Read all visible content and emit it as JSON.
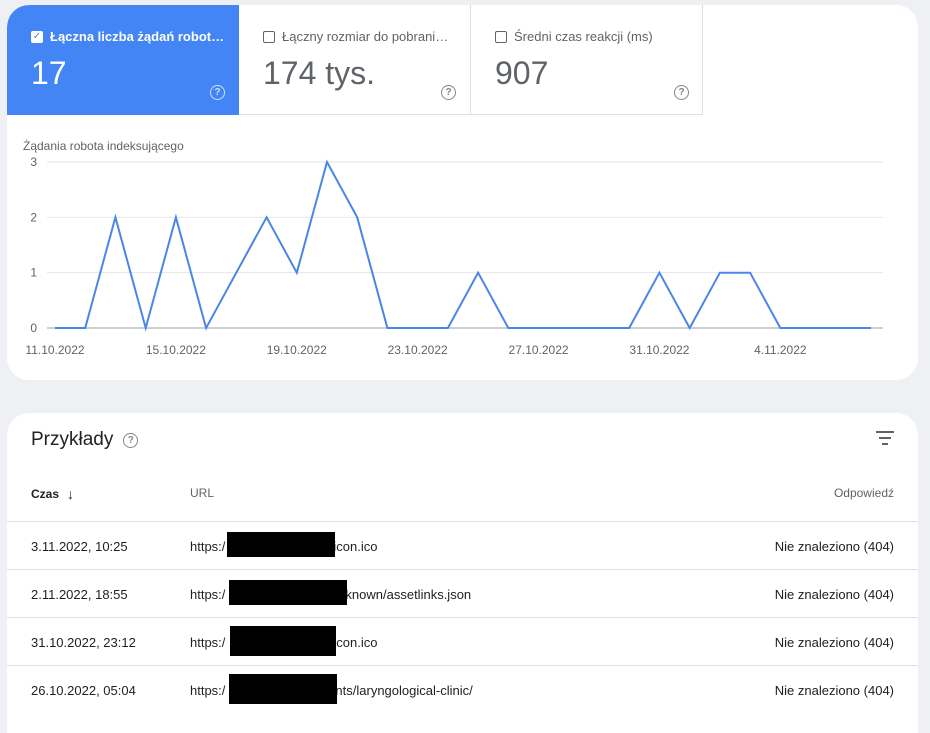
{
  "metrics": [
    {
      "label": "Łączna liczba żądań robot…",
      "value": "17",
      "checked": true
    },
    {
      "label": "Łączny rozmiar do pobrani…",
      "value": "174 tys.",
      "checked": false
    },
    {
      "label": "Średni czas reakcji (ms)",
      "value": "907",
      "checked": false
    }
  ],
  "help_glyph": "?",
  "check_glyph": "✓",
  "chart_data": {
    "type": "line",
    "ylabel": "Żądania robota indeksującego",
    "ylim": [
      0,
      3
    ],
    "yticks": [
      "0",
      "1",
      "2",
      "3"
    ],
    "x_tick_labels": [
      "11.10.2022",
      "15.10.2022",
      "19.10.2022",
      "23.10.2022",
      "27.10.2022",
      "31.10.2022",
      "4.11.2022"
    ],
    "x": [
      "11.10.2022",
      "12.10.2022",
      "13.10.2022",
      "14.10.2022",
      "15.10.2022",
      "16.10.2022",
      "17.10.2022",
      "18.10.2022",
      "19.10.2022",
      "20.10.2022",
      "21.10.2022",
      "22.10.2022",
      "23.10.2022",
      "24.10.2022",
      "25.10.2022",
      "26.10.2022",
      "27.10.2022",
      "28.10.2022",
      "29.10.2022",
      "30.10.2022",
      "31.10.2022",
      "1.11.2022",
      "2.11.2022",
      "3.11.2022",
      "4.11.2022",
      "5.11.2022",
      "6.11.2022",
      "7.11.2022"
    ],
    "values": [
      0,
      0,
      2,
      0,
      2,
      0,
      1,
      2,
      1,
      3,
      2,
      0,
      0,
      0,
      1,
      0,
      0,
      0,
      0,
      0,
      1,
      0,
      1,
      1,
      0,
      0,
      0,
      0
    ],
    "color": "#4a86e8",
    "grid": true
  },
  "examples": {
    "title": "Przykłady",
    "columns": {
      "time": "Czas",
      "url": "URL",
      "response": "Odpowiedź"
    },
    "sort_arrow": "↓",
    "rows": [
      {
        "time": "3.11.2022, 10:25",
        "url_prefix": "https:/",
        "url_suffix": "icon.ico",
        "response": "Nie znaleziono (404)"
      },
      {
        "time": "2.11.2022, 18:55",
        "url_prefix": "https:/",
        "url_suffix": "known/assetlinks.json",
        "response": "Nie znaleziono (404)"
      },
      {
        "time": "31.10.2022, 23:12",
        "url_prefix": "https:/",
        "url_suffix": "icon.ico",
        "response": "Nie znaleziono (404)"
      },
      {
        "time": "26.10.2022, 05:04",
        "url_prefix": "https:/",
        "url_suffix": "nts/laryngological-clinic/",
        "response": "Nie znaleziono (404)"
      }
    ]
  }
}
